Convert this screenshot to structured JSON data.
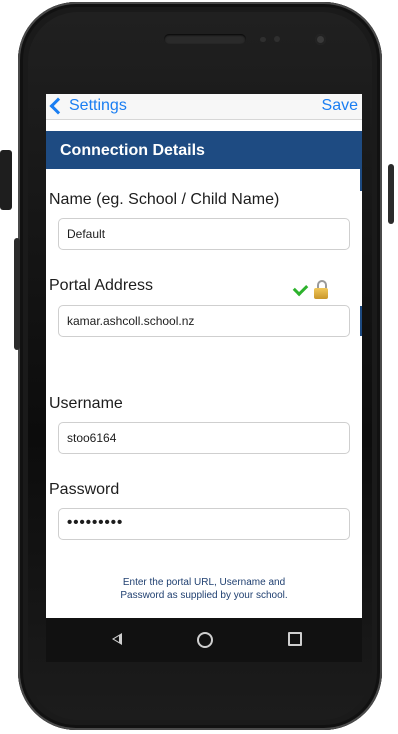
{
  "nav": {
    "back_label": "Settings",
    "save_label": "Save"
  },
  "section": {
    "title": "Connection Details"
  },
  "fields": {
    "name": {
      "label": "Name  (eg. School / Child Name)",
      "value": "Default"
    },
    "portal": {
      "label": "Portal Address",
      "value": "kamar.ashcoll.school.nz"
    },
    "username": {
      "label": "Username",
      "value": "stoo6164"
    },
    "password": {
      "label": "Password",
      "value": "•••••••••"
    }
  },
  "help": {
    "line1": "Enter the portal URL, Username and",
    "line2": "Password as supplied by your school."
  },
  "colors": {
    "accent": "#1a7ef2",
    "header": "#1e4b82",
    "check": "#2db22d"
  },
  "icons": [
    "chevron-left-icon",
    "checkmark-icon",
    "lock-icon",
    "android-back-icon",
    "android-home-icon",
    "android-recents-icon"
  ]
}
